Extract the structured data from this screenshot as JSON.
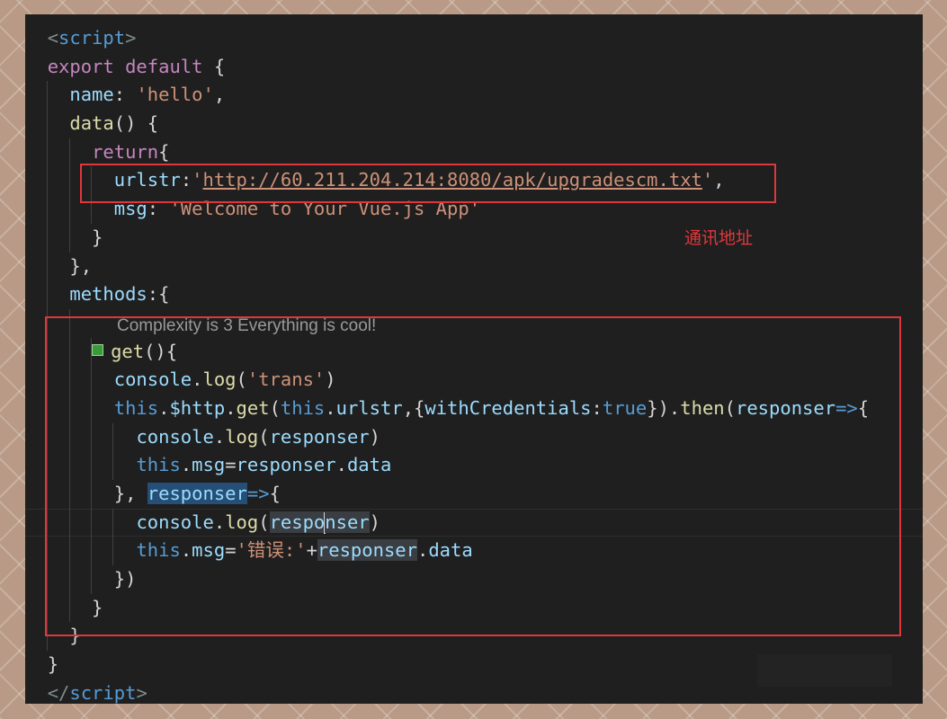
{
  "annotation": {
    "text": "通讯地址"
  },
  "codelens": {
    "text": "Complexity is 3 Everything is cool!"
  },
  "code": {
    "lines": [
      [
        [
          "tag",
          "<"
        ],
        [
          "tn",
          "script"
        ],
        [
          "tag",
          ">"
        ]
      ],
      [
        [
          "kw",
          "export"
        ],
        [
          "pn",
          " "
        ],
        [
          "kw",
          "default"
        ],
        [
          "pn",
          " {"
        ]
      ],
      [
        [
          "pn",
          "  "
        ],
        [
          "prop",
          "name"
        ],
        [
          "pn",
          ": "
        ],
        [
          "str",
          "'hello'"
        ],
        [
          "pn",
          ","
        ]
      ],
      [
        [
          "pn",
          "  "
        ],
        [
          "fn",
          "data"
        ],
        [
          "pn",
          "() {"
        ]
      ],
      [
        [
          "pn",
          "    "
        ],
        [
          "kw",
          "return"
        ],
        [
          "pn",
          "{"
        ]
      ],
      [
        [
          "pn",
          "      "
        ],
        [
          "prop",
          "urlstr"
        ],
        [
          "pn",
          ":"
        ],
        [
          "str",
          "'"
        ],
        [
          "str url",
          "http://60.211.204.214:8080/apk/upgradescm.txt"
        ],
        [
          "str",
          "'"
        ],
        [
          "pn",
          ","
        ]
      ],
      [
        [
          "pn",
          "      "
        ],
        [
          "prop",
          "msg"
        ],
        [
          "pn",
          ": "
        ],
        [
          "str",
          "'Welcome to Your Vue.js App'"
        ]
      ],
      [
        [
          "pn",
          "    }"
        ]
      ],
      [
        [
          "pn",
          "  },"
        ]
      ],
      [
        [
          "pn",
          "  "
        ],
        [
          "prop",
          "methods"
        ],
        [
          "pn",
          ":{"
        ]
      ],
      [],
      [
        [
          "pn",
          "    "
        ],
        [
          "glyph",
          ""
        ],
        [
          "fn",
          "get"
        ],
        [
          "pn",
          "(){"
        ]
      ],
      [
        [
          "pn",
          "      "
        ],
        [
          "prop",
          "console"
        ],
        [
          "pn",
          "."
        ],
        [
          "fn",
          "log"
        ],
        [
          "pn",
          "("
        ],
        [
          "str",
          "'trans'"
        ],
        [
          "pn",
          ")"
        ]
      ],
      [
        [
          "pn",
          "      "
        ],
        [
          "bl",
          "this"
        ],
        [
          "pn",
          "."
        ],
        [
          "prop",
          "$http"
        ],
        [
          "pn",
          "."
        ],
        [
          "fn",
          "get"
        ],
        [
          "pn",
          "("
        ],
        [
          "bl",
          "this"
        ],
        [
          "pn",
          "."
        ],
        [
          "prop",
          "urlstr"
        ],
        [
          "pn",
          ",{"
        ],
        [
          "prop",
          "withCredentials"
        ],
        [
          "pn",
          ":"
        ],
        [
          "bl",
          "true"
        ],
        [
          "pn",
          "})."
        ],
        [
          "fn",
          "then"
        ],
        [
          "pn",
          "("
        ],
        [
          "prop",
          "responser"
        ],
        [
          "bl",
          "=>"
        ],
        [
          "pn",
          "{"
        ]
      ],
      [
        [
          "pn",
          "        "
        ],
        [
          "prop",
          "console"
        ],
        [
          "pn",
          "."
        ],
        [
          "fn",
          "log"
        ],
        [
          "pn",
          "("
        ],
        [
          "prop",
          "responser"
        ],
        [
          "pn",
          ")"
        ]
      ],
      [
        [
          "pn",
          "        "
        ],
        [
          "bl",
          "this"
        ],
        [
          "pn",
          "."
        ],
        [
          "prop",
          "msg"
        ],
        [
          "pn",
          "="
        ],
        [
          "prop",
          "responser"
        ],
        [
          "pn",
          "."
        ],
        [
          "prop",
          "data"
        ]
      ],
      [
        [
          "pn",
          "      }, "
        ],
        [
          "prop hl",
          "responser"
        ],
        [
          "bl",
          "=>"
        ],
        [
          "pn",
          "{"
        ]
      ],
      [
        [
          "pn",
          "        "
        ],
        [
          "prop",
          "console"
        ],
        [
          "pn",
          "."
        ],
        [
          "fn",
          "log"
        ],
        [
          "pn",
          "("
        ],
        [
          "prop hl2",
          "respo"
        ],
        [
          "cursor",
          ""
        ],
        [
          "prop hl2",
          "nser"
        ],
        [
          "pn",
          ")"
        ]
      ],
      [
        [
          "pn",
          "        "
        ],
        [
          "bl",
          "this"
        ],
        [
          "pn",
          "."
        ],
        [
          "prop",
          "msg"
        ],
        [
          "pn",
          "="
        ],
        [
          "str",
          "'错误:'"
        ],
        [
          "pn",
          "+"
        ],
        [
          "prop hl2",
          "responser"
        ],
        [
          "pn",
          "."
        ],
        [
          "prop",
          "data"
        ]
      ],
      [
        [
          "pn",
          "      })"
        ]
      ],
      [
        [
          "pn",
          "    }"
        ]
      ],
      [
        [
          "pn",
          "  }"
        ]
      ],
      [
        [
          "pn",
          "}"
        ]
      ],
      [
        [
          "tag",
          "</"
        ],
        [
          "tn",
          "script"
        ],
        [
          "tag",
          ">"
        ]
      ]
    ]
  }
}
